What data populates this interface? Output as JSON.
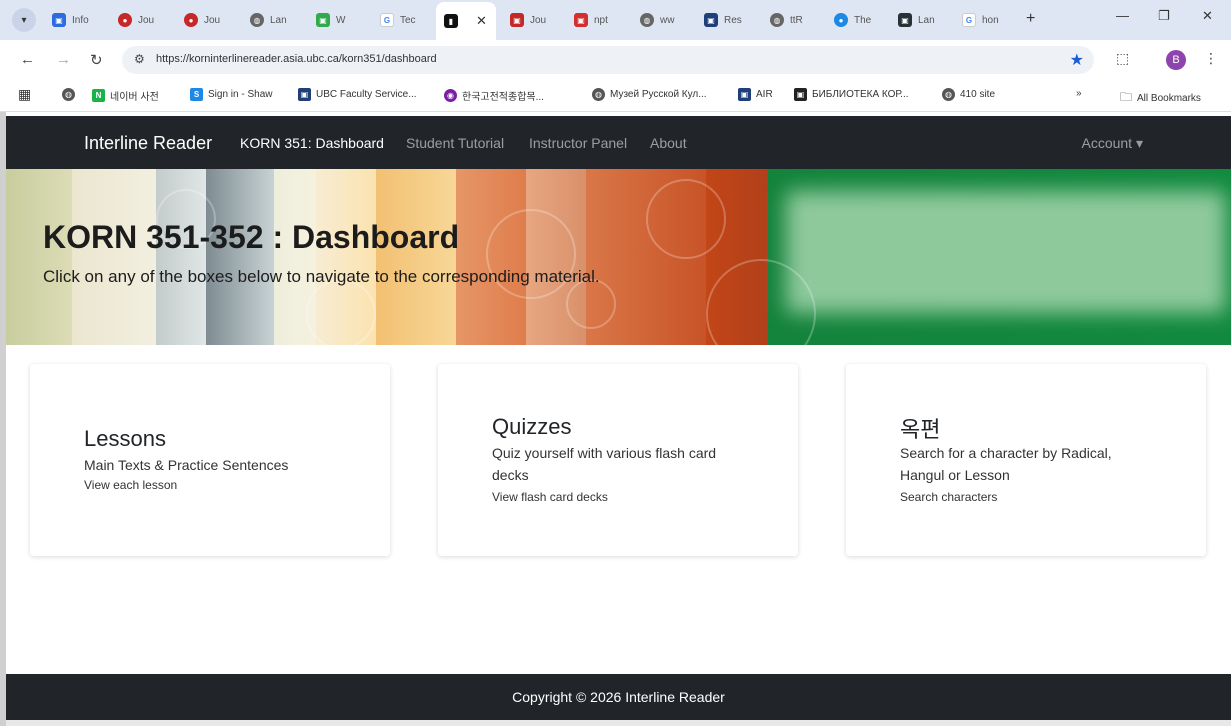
{
  "browser": {
    "tabs": [
      {
        "label": "Info",
        "fav_color": "#2d6cdf",
        "fav_glyph": "▣"
      },
      {
        "label": "Jou",
        "fav_color": "#c62828",
        "fav_glyph": "●"
      },
      {
        "label": "Jou",
        "fav_color": "#c62828",
        "fav_glyph": "●"
      },
      {
        "label": "Lan",
        "fav_color": "#666666",
        "fav_glyph": "◍"
      },
      {
        "label": "W",
        "fav_color": "#2eab4a",
        "fav_glyph": "▣"
      },
      {
        "label": "Tec",
        "fav_color": "#ffffff",
        "fav_glyph": "G"
      },
      {
        "label": "",
        "fav_color": "#111111",
        "fav_glyph": "▮",
        "active": true
      },
      {
        "label": "Jou",
        "fav_color": "#c62828",
        "fav_glyph": "▣"
      },
      {
        "label": "npt",
        "fav_color": "#d32f2f",
        "fav_glyph": "▣"
      },
      {
        "label": "ww",
        "fav_color": "#666666",
        "fav_glyph": "◍"
      },
      {
        "label": "Res",
        "fav_color": "#1f3f7a",
        "fav_glyph": "▣"
      },
      {
        "label": "ttR",
        "fav_color": "#666666",
        "fav_glyph": "◍"
      },
      {
        "label": "The",
        "fav_color": "#1e88e5",
        "fav_glyph": "●"
      },
      {
        "label": "Lan",
        "fav_color": "#263238",
        "fav_glyph": "▣"
      },
      {
        "label": "hon",
        "fav_color": "#ffffff",
        "fav_glyph": "G"
      }
    ],
    "url": "https://korninterlinereader.asia.ubc.ca/korn351/dashboard",
    "profile_initial": "B",
    "bookmarks": [
      {
        "label": "",
        "fav_color": "#555555",
        "fav_glyph": "◍"
      },
      {
        "label": "네이버 사전",
        "fav_color": "#19b34a",
        "fav_glyph": "N"
      },
      {
        "label": "Sign in - Shaw",
        "fav_color": "#1e88e5",
        "fav_glyph": "S"
      },
      {
        "label": "UBC Faculty Service...",
        "fav_color": "#1f3f7a",
        "fav_glyph": "▣"
      },
      {
        "label": "한국고전적종합목...",
        "fav_color": "#7b1fa2",
        "fav_glyph": "◉"
      },
      {
        "label": "Музей Русской Кул...",
        "fav_color": "#555555",
        "fav_glyph": "◍"
      },
      {
        "label": "AIR",
        "fav_color": "#1f3f7a",
        "fav_glyph": "▣"
      },
      {
        "label": "БИБЛИОТЕКА КОР...",
        "fav_color": "#222222",
        "fav_glyph": "▣"
      },
      {
        "label": "410 site",
        "fav_color": "#555555",
        "fav_glyph": "◍"
      }
    ],
    "all_bookmarks": "All Bookmarks"
  },
  "navbar": {
    "brand": "Interline Reader",
    "links": [
      "KORN 351: Dashboard",
      "Student Tutorial",
      "Instructor Panel",
      "About"
    ],
    "account": "Account ▾"
  },
  "banner": {
    "title": "KORN 351-352 : Dashboard",
    "subtitle": "Click on any of the boxes below to navigate to the corresponding material."
  },
  "cards": [
    {
      "title": "Lessons",
      "text": "Main Texts & Practice Sentences",
      "link": "View each lesson"
    },
    {
      "title": "Quizzes",
      "text": "Quiz yourself with various flash card decks",
      "link": "View flash card decks"
    },
    {
      "title": "옥편",
      "text": "Search for a character by Radical, Hangul or Lesson",
      "link": "Search characters"
    }
  ],
  "footer": {
    "copyright": "Copyright © 2026 Interline Reader"
  }
}
